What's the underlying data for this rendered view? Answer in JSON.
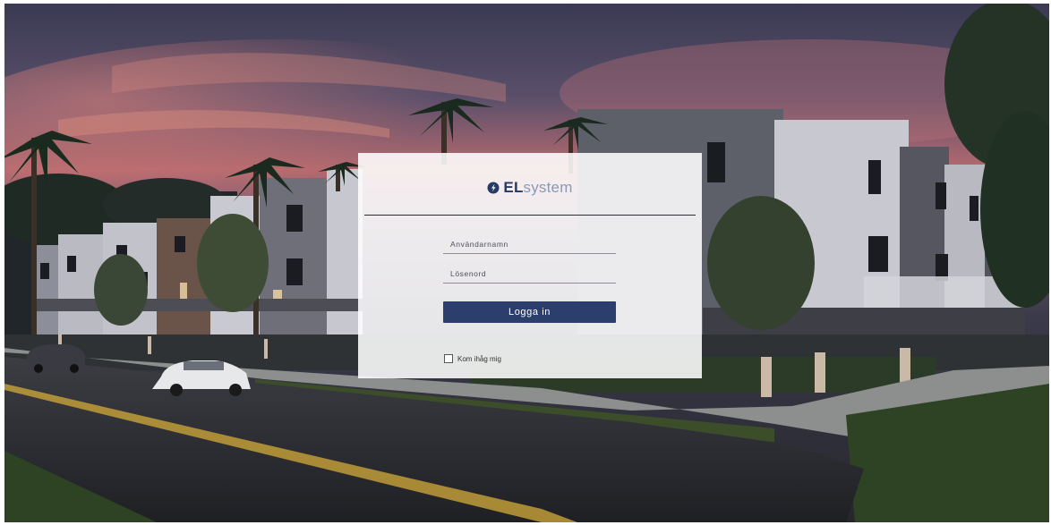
{
  "login": {
    "logo": {
      "icon": "lightning-drop-icon",
      "brand_bold": "EL",
      "brand_light": "system",
      "color_bold": "#263a66",
      "color_light": "#8a9ab5"
    },
    "username_placeholder": "Användarnamn",
    "password_placeholder": "Lösenord",
    "login_button_label": "Logga in",
    "remember_label": "Kom ihåg mig",
    "remember_checked": false,
    "button_color": "#2c3e6c"
  },
  "background": {
    "description_icon": "residential-street-dusk-photo",
    "sky_color": "#5a4f6b",
    "accent_color": "#d8786a"
  }
}
